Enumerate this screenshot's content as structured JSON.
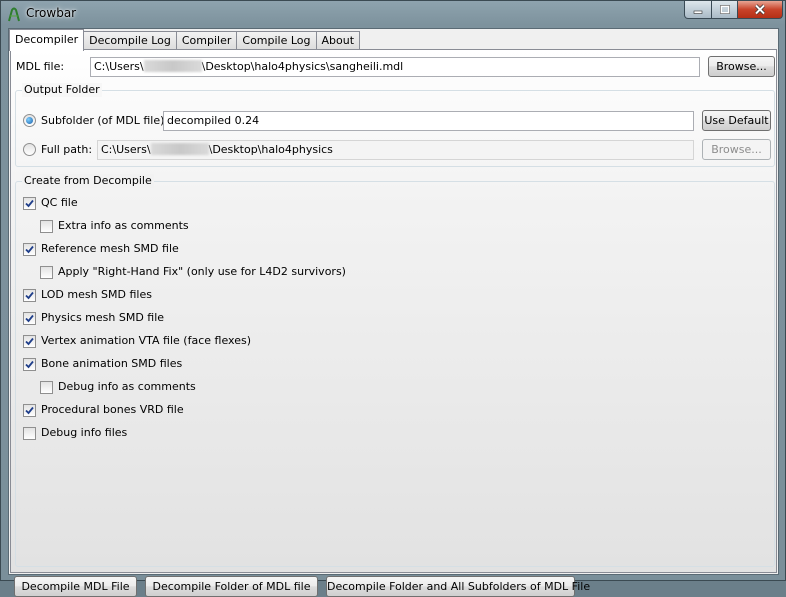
{
  "window": {
    "title": "Crowbar",
    "accent_close": "#c8432a"
  },
  "tabs": [
    {
      "label": "Decompiler",
      "active": true
    },
    {
      "label": "Decompile Log",
      "active": false
    },
    {
      "label": "Compiler",
      "active": false
    },
    {
      "label": "Compile Log",
      "active": false
    },
    {
      "label": "About",
      "active": false
    }
  ],
  "mdl": {
    "label": "MDL file:",
    "path_prefix": "C:\\Users\\",
    "path_suffix": "\\Desktop\\halo4physics\\sangheili.mdl",
    "browse_label": "Browse..."
  },
  "output": {
    "group_title": "Output Folder",
    "subfolder_label": "Subfolder (of MDL file):",
    "subfolder_value": "decompiled 0.24",
    "use_default_label": "Use Default",
    "fullpath_label": "Full path:",
    "fullpath_prefix": "C:\\Users\\",
    "fullpath_suffix": "\\Desktop\\halo4physics",
    "browse_label": "Browse...",
    "selected": "subfolder"
  },
  "create": {
    "group_title": "Create from Decompile",
    "options": [
      {
        "label": "QC file",
        "checked": true,
        "indent": false
      },
      {
        "label": "Extra info as comments",
        "checked": false,
        "indent": true
      },
      {
        "label": "Reference mesh SMD file",
        "checked": true,
        "indent": false
      },
      {
        "label": "Apply \"Right-Hand Fix\" (only use for L4D2 survivors)",
        "checked": false,
        "indent": true
      },
      {
        "label": "LOD mesh SMD files",
        "checked": true,
        "indent": false
      },
      {
        "label": "Physics mesh SMD file",
        "checked": true,
        "indent": false
      },
      {
        "label": "Vertex animation VTA file (face flexes)",
        "checked": true,
        "indent": false
      },
      {
        "label": "Bone animation SMD files",
        "checked": true,
        "indent": false
      },
      {
        "label": "Debug info as comments",
        "checked": false,
        "indent": true
      },
      {
        "label": "Procedural bones VRD file",
        "checked": true,
        "indent": false
      },
      {
        "label": "Debug info files",
        "checked": false,
        "indent": false
      }
    ]
  },
  "actions": {
    "decompile_file": "Decompile MDL File",
    "decompile_folder": "Decompile Folder of MDL file",
    "decompile_all": "Decompile Folder and All Subfolders of MDL File"
  }
}
